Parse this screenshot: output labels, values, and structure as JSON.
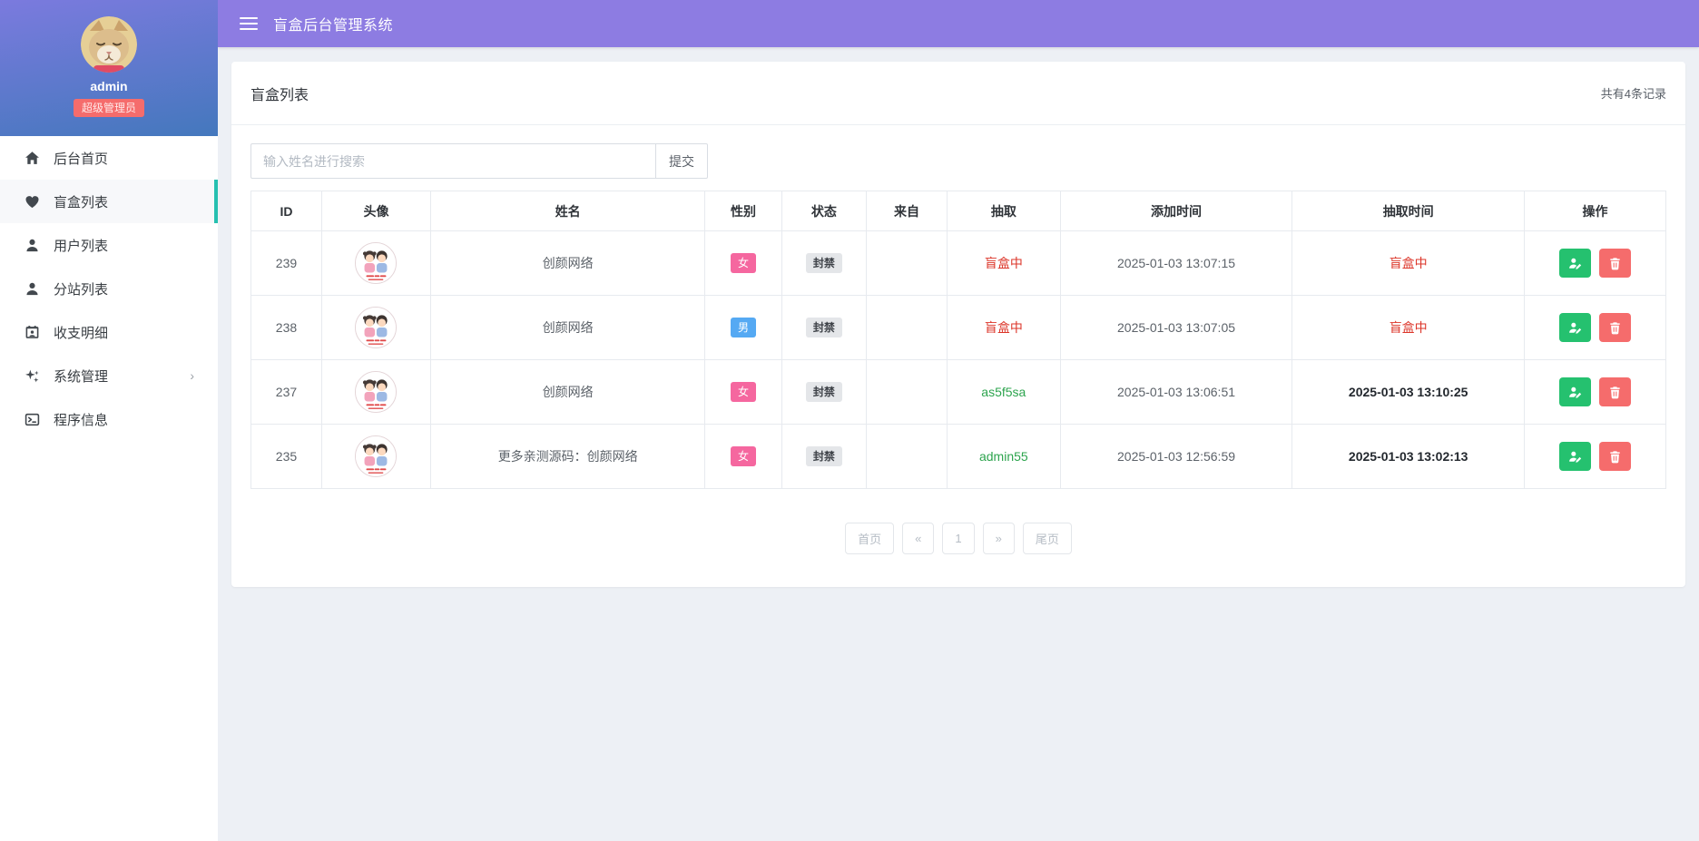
{
  "app": {
    "title": "盲盒后台管理系统"
  },
  "sidebar": {
    "username": "admin",
    "role_badge": "超级管理员",
    "items": [
      {
        "label": "后台首页",
        "icon": "home-icon",
        "active": false,
        "has_submenu": false
      },
      {
        "label": "盲盒列表",
        "icon": "heart-icon",
        "active": true,
        "has_submenu": false
      },
      {
        "label": "用户列表",
        "icon": "user-icon",
        "active": false,
        "has_submenu": false
      },
      {
        "label": "分站列表",
        "icon": "user-icon",
        "active": false,
        "has_submenu": false
      },
      {
        "label": "收支明细",
        "icon": "contact-card-icon",
        "active": false,
        "has_submenu": false
      },
      {
        "label": "系统管理",
        "icon": "sparkles-icon",
        "active": false,
        "has_submenu": true
      },
      {
        "label": "程序信息",
        "icon": "terminal-icon",
        "active": false,
        "has_submenu": false
      }
    ],
    "submenu_caret": "›"
  },
  "page": {
    "card_title": "盲盒列表",
    "record_count": "共有4条记录",
    "search": {
      "placeholder": "输入姓名进行搜索",
      "submit_label": "提交"
    }
  },
  "table": {
    "headers": [
      "ID",
      "头像",
      "姓名",
      "性别",
      "状态",
      "来自",
      "抽取",
      "添加时间",
      "抽取时间",
      "操作"
    ],
    "rows": [
      {
        "id": "239",
        "name": "创颜网络",
        "gender": "女",
        "gender_style": "female",
        "status": "封禁",
        "from": "",
        "draw": "盲盒中",
        "draw_style": "red",
        "added_time": "2025-01-03 13:07:15",
        "draw_time": "盲盒中",
        "draw_time_style": "red"
      },
      {
        "id": "238",
        "name": "创颜网络",
        "gender": "男",
        "gender_style": "male",
        "status": "封禁",
        "from": "",
        "draw": "盲盒中",
        "draw_style": "red",
        "added_time": "2025-01-03 13:07:05",
        "draw_time": "盲盒中",
        "draw_time_style": "red"
      },
      {
        "id": "237",
        "name": "创颜网络",
        "gender": "女",
        "gender_style": "female",
        "status": "封禁",
        "from": "",
        "draw": "as5f5sa",
        "draw_style": "green",
        "added_time": "2025-01-03 13:06:51",
        "draw_time": "2025-01-03 13:10:25",
        "draw_time_style": "dark"
      },
      {
        "id": "235",
        "name": "更多亲测源码：创颜网络",
        "gender": "女",
        "gender_style": "female",
        "status": "封禁",
        "from": "",
        "draw": "admin55",
        "draw_style": "green",
        "added_time": "2025-01-03 12:56:59",
        "draw_time": "2025-01-03 13:02:13",
        "draw_time_style": "dark"
      }
    ],
    "action_icons": {
      "edit": "user-edit-icon",
      "delete": "trash-icon"
    }
  },
  "pagination": {
    "items": [
      "首页",
      "«",
      "1",
      "»",
      "尾页"
    ]
  },
  "colors": {
    "accent": "#8d7ce2",
    "grad-top": "#7b7ade",
    "grad-bottom": "#4478bd",
    "teal": "#26c0b0",
    "pink": "#f5679f",
    "blue": "#55a9f3",
    "badge-red": "#f56c6c",
    "red-text": "#dc3529",
    "green-text": "#2da44e",
    "btn-green": "#25c16f",
    "btn-red": "#f56c6c"
  }
}
